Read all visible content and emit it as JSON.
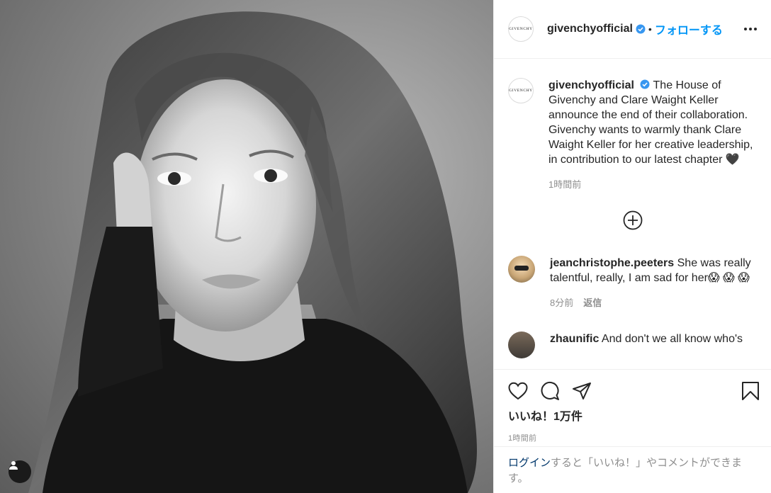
{
  "post": {
    "username": "givenchyofficial",
    "avatar_text": "GIVENCHY",
    "separator": "•",
    "follow_label": "フォローする",
    "more_icon": "more-options-icon"
  },
  "caption": {
    "username": "givenchyofficial",
    "text": "The House of Givenchy and Clare Waight Keller announce the end of their collaboration. Givenchy wants to warmly thank Clare Waight Keller for her creative leadership, in contribution to our latest chapter 🖤",
    "time": "1時間前"
  },
  "comments": [
    {
      "username": "jeanchristophe.peeters",
      "text": "She was really talentful, really, I am sad for her😱 😱 😱",
      "time": "8分前",
      "reply_label": "返信"
    },
    {
      "username": "zhaunific",
      "text": "And don't we all know who's"
    }
  ],
  "actions": {
    "likes": "いいね！1万件",
    "time": "1時間前"
  },
  "login": {
    "link": "ログイン",
    "text": "すると「いいね！」やコメントができます。"
  },
  "colors": {
    "accent": "#0095f6",
    "verified": "#3897f0",
    "muted": "#8e8e8e",
    "link": "#00376b"
  }
}
